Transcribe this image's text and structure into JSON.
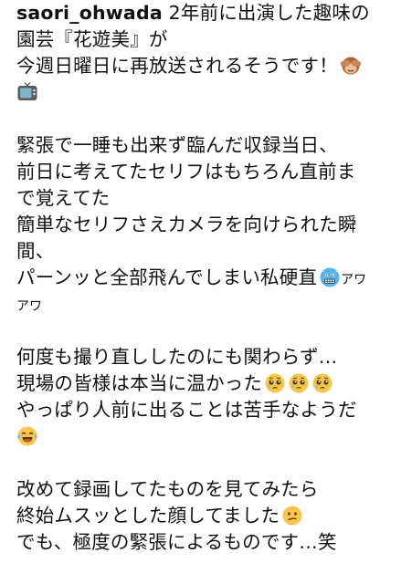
{
  "post": {
    "username": "saori_ohwada",
    "lines": {
      "l1": " 2年前に出演した趣味の",
      "l2": "園芸『花遊美』が",
      "l3": "今週日曜日に再放送されるそうです！",
      "l5": "緊張で一睡も出来ず臨んだ収録当日、",
      "l6": "前日に考えてたセリフはもちろん直前ま",
      "l7": "で覚えてた",
      "l8": "簡単なセリフさえカメラを向けられた瞬",
      "l9": "間、",
      "l10": "パーンッと全部飛んでしまい私硬直",
      "l10b": "アワ",
      "l11": "アワ",
      "l13": "何度も撮り直ししたのにも関わらず…",
      "l14": "現場の皆様は本当に温かった",
      "l15": "やっぱり人前に出ることは苦手なようだ",
      "l17": "改めて録画してたものを見てみたら",
      "l18": "終始ムスッとした顔してました",
      "l19": "でも、極度の緊張によるものです…笑"
    },
    "emojis": {
      "see_no_evil": "see-no-evil-monkey-icon",
      "tv": "television-icon",
      "cold_face": "cold-face-icon",
      "pleading": "pleading-face-icon",
      "joy": "tears-of-joy-icon",
      "confused": "confused-face-icon"
    },
    "colors": {
      "text": "#111111",
      "background": "#ffffff"
    }
  }
}
